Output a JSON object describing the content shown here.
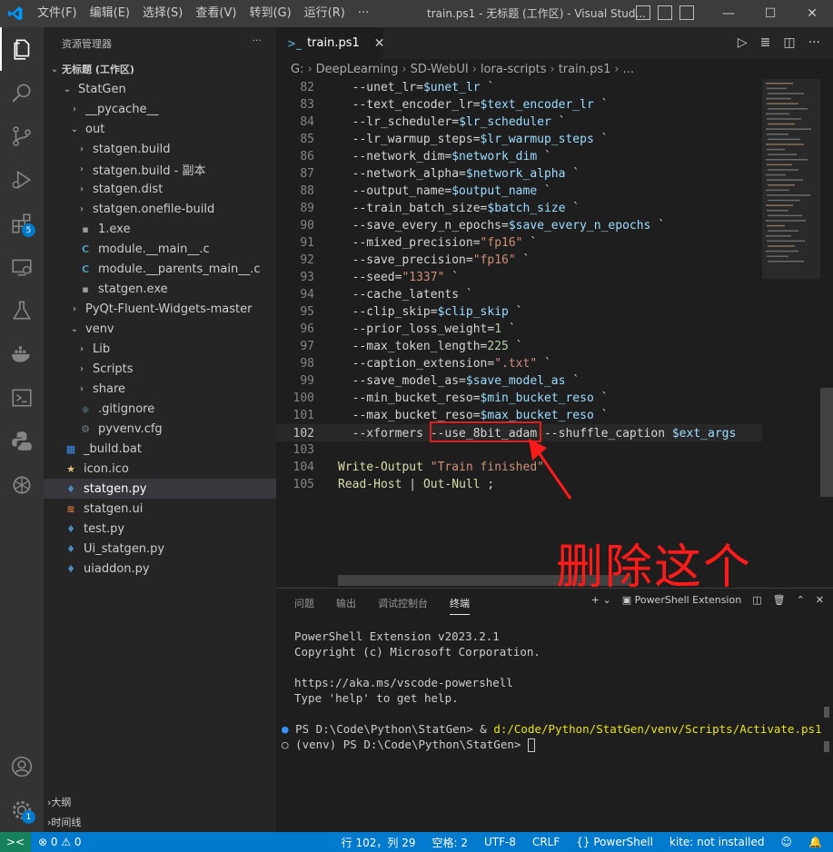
{
  "titlebar": {
    "menu": [
      "文件(F)",
      "编辑(E)",
      "选择(S)",
      "查看(V)",
      "转到(G)",
      "运行(R)",
      "···"
    ],
    "title": "train.ps1 - 无标题 (工作区) - Visual Stud...",
    "min": "—",
    "max": "☐",
    "close": "✕"
  },
  "activitybar": {
    "extensions_badge": "5",
    "settings_badge": "1"
  },
  "sidebar": {
    "title": "资源管理器",
    "more": "···",
    "workspace": "无标题 (工作区)",
    "tree": [
      {
        "label": "StatGen",
        "chev": "⌄",
        "icon": "",
        "indent": 18,
        "color": "#cccccc"
      },
      {
        "label": "__pycache__",
        "chev": "›",
        "icon": "",
        "indent": 26,
        "color": "#cccccc"
      },
      {
        "label": "out",
        "chev": "⌄",
        "icon": "",
        "indent": 26,
        "color": "#cccccc"
      },
      {
        "label": "statgen.build",
        "chev": "›",
        "icon": "",
        "indent": 34,
        "color": "#cccccc"
      },
      {
        "label": "statgen.build - 副本",
        "chev": "›",
        "icon": "",
        "indent": 34,
        "color": "#cccccc"
      },
      {
        "label": "statgen.dist",
        "chev": "›",
        "icon": "",
        "indent": 34,
        "color": "#cccccc"
      },
      {
        "label": "statgen.onefile-build",
        "chev": "›",
        "icon": "",
        "indent": 34,
        "color": "#cccccc"
      },
      {
        "label": "1.exe",
        "chev": "",
        "icon": "▪",
        "indent": 34,
        "color": "#cccccc",
        "icolor": "#9b9b9b"
      },
      {
        "label": "module.__main__.c",
        "chev": "",
        "icon": "C",
        "indent": 34,
        "color": "#cccccc",
        "icolor": "#519aba"
      },
      {
        "label": "module.__parents_main__.c",
        "chev": "",
        "icon": "C",
        "indent": 34,
        "color": "#cccccc",
        "icolor": "#519aba"
      },
      {
        "label": "statgen.exe",
        "chev": "",
        "icon": "▪",
        "indent": 34,
        "color": "#cccccc",
        "icolor": "#9b9b9b"
      },
      {
        "label": "PyQt-Fluent-Widgets-master",
        "chev": "›",
        "icon": "",
        "indent": 26,
        "color": "#cccccc"
      },
      {
        "label": "venv",
        "chev": "⌄",
        "icon": "",
        "indent": 26,
        "color": "#cccccc"
      },
      {
        "label": "Lib",
        "chev": "›",
        "icon": "",
        "indent": 34,
        "color": "#cccccc"
      },
      {
        "label": "Scripts",
        "chev": "›",
        "icon": "",
        "indent": 34,
        "color": "#cccccc"
      },
      {
        "label": "share",
        "chev": "›",
        "icon": "",
        "indent": 34,
        "color": "#cccccc"
      },
      {
        "label": ".gitignore",
        "chev": "",
        "icon": "◆",
        "indent": 34,
        "color": "#cccccc",
        "icolor": "#41535b"
      },
      {
        "label": "pyvenv.cfg",
        "chev": "",
        "icon": "⚙",
        "indent": 34,
        "color": "#cccccc",
        "icolor": "#6d8086"
      },
      {
        "label": "_build.bat",
        "chev": "",
        "icon": "▦",
        "indent": 18,
        "color": "#cccccc",
        "icolor": "#3b8eea"
      },
      {
        "label": "icon.ico",
        "chev": "",
        "icon": "★",
        "indent": 18,
        "color": "#cccccc",
        "icolor": "#e5c07b"
      },
      {
        "label": "statgen.py",
        "chev": "",
        "icon": "♦",
        "indent": 18,
        "color": "#ffffff",
        "icolor": "#4b8bbe",
        "selected": true
      },
      {
        "label": "statgen.ui",
        "chev": "",
        "icon": "≋",
        "indent": 18,
        "color": "#cccccc",
        "icolor": "#e37933"
      },
      {
        "label": "test.py",
        "chev": "",
        "icon": "♦",
        "indent": 18,
        "color": "#cccccc",
        "icolor": "#4b8bbe"
      },
      {
        "label": "Ui_statgen.py",
        "chev": "",
        "icon": "♦",
        "indent": 18,
        "color": "#cccccc",
        "icolor": "#4b8bbe"
      },
      {
        "label": "uiaddon.py",
        "chev": "",
        "icon": "♦",
        "indent": 18,
        "color": "#cccccc",
        "icolor": "#4b8bbe"
      }
    ],
    "outline": "大纲",
    "timeline": "时间线"
  },
  "editor": {
    "tab_label": "train.ps1",
    "tab_close": "✕",
    "breadcrumb": [
      "G:",
      "DeepLearning",
      "SD-WebUI",
      "lora-scripts",
      "train.ps1",
      "..."
    ],
    "lines": [
      {
        "n": "82",
        "html": "  <span class='op'>--unet_lr=</span><span class='var'>$unet_lr</span> `"
      },
      {
        "n": "83",
        "html": "  --text_encoder_lr=<span class='var'>$text_encoder_lr</span> `"
      },
      {
        "n": "84",
        "html": "  --lr_scheduler=<span class='var'>$lr_scheduler</span> `"
      },
      {
        "n": "85",
        "html": "  --lr_warmup_steps=<span class='var'>$lr_warmup_steps</span> `"
      },
      {
        "n": "86",
        "html": "  --network_dim=<span class='var'>$network_dim</span> `"
      },
      {
        "n": "87",
        "html": "  --network_alpha=<span class='var'>$network_alpha</span> `"
      },
      {
        "n": "88",
        "html": "  --output_name=<span class='var'>$output_name</span> `"
      },
      {
        "n": "89",
        "html": "  --train_batch_size=<span class='var'>$batch_size</span> `"
      },
      {
        "n": "90",
        "html": "  --save_every_n_epochs=<span class='var'>$save_every_n_epochs</span> `"
      },
      {
        "n": "91",
        "html": "  --mixed_precision=<span class='str'>\"fp16\"</span> `"
      },
      {
        "n": "92",
        "html": "  --save_precision=<span class='str'>\"fp16\"</span> `"
      },
      {
        "n": "93",
        "html": "  --seed=<span class='str'>\"1337\"</span> `"
      },
      {
        "n": "94",
        "html": "  --cache_latents `"
      },
      {
        "n": "95",
        "html": "  --clip_skip=<span class='var'>$clip_skip</span> `"
      },
      {
        "n": "96",
        "html": "  --prior_loss_weight=<span class='num'>1</span> `"
      },
      {
        "n": "97",
        "html": "  --max_token_length=<span class='num'>225</span> `"
      },
      {
        "n": "98",
        "html": "  --caption_extension=<span class='str'>\".txt\"</span> `"
      },
      {
        "n": "99",
        "html": "  --save_model_as=<span class='var'>$save_model_as</span> `"
      },
      {
        "n": "100",
        "html": "  --min_bucket_reso=<span class='var'>$min_bucket_reso</span> `"
      },
      {
        "n": "101",
        "html": "  --max_bucket_reso=<span class='var'>$max_bucket_reso</span> `"
      },
      {
        "n": "102",
        "html": "  --xformers --use_8bit_adam --shuffle_caption <span class='var'>$ext_args</span>",
        "current": true
      },
      {
        "n": "103",
        "html": ""
      },
      {
        "n": "104",
        "html": "<span class='cmd'>Write-Output</span> <span class='str'>\"Train finished\"</span>"
      },
      {
        "n": "105",
        "html": "<span class='cmd'>Read-Host</span> | <span class='cmd'>Out-Null</span> ;"
      }
    ]
  },
  "annotation": {
    "text": "删除这个"
  },
  "panel": {
    "tabs": [
      "问题",
      "输出",
      "调试控制台",
      "终端"
    ],
    "active_tab": "终端",
    "add": "+ ⌄",
    "terminal_name": "PowerShell Extension",
    "terminal": {
      "line1": "PowerShell Extension v2023.2.1",
      "line2": "Copyright (c) Microsoft Corporation.",
      "line3": "https://aka.ms/vscode-powershell",
      "line4": "Type 'help' to get help.",
      "prompt1_dot": "●",
      "prompt1_pre": "PS D:\\Code\\Python\\StatGen> & ",
      "prompt1_path": "d:/Code/Python/StatGen/venv/Scripts/Activate.ps1",
      "prompt2_dot": "○",
      "prompt2": "(venv) PS D:\\Code\\Python\\StatGen> "
    }
  },
  "statusbar": {
    "remote": "><",
    "problems": "⊗ 0 ⚠ 0",
    "position": "行 102，列 29",
    "spaces": "空格: 2",
    "encoding": "UTF-8",
    "eol": "CRLF",
    "language": "{} PowerShell",
    "kite": "kite: not installed"
  }
}
